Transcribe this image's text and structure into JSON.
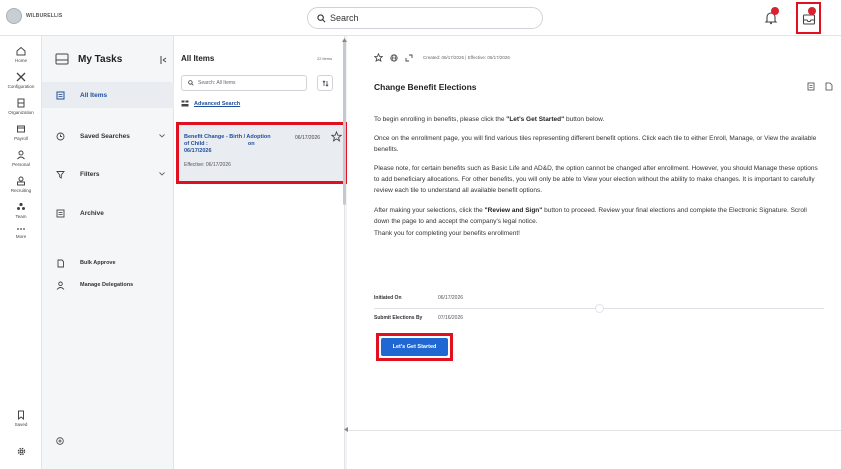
{
  "brand": {
    "name": "WILBURELLIS"
  },
  "search": {
    "label": "Search"
  },
  "nav": [
    {
      "label": "Home"
    },
    {
      "label": "Configuration"
    },
    {
      "label": "Organization"
    },
    {
      "label": "Payroll"
    },
    {
      "label": "Personal"
    },
    {
      "label": "Recruiting"
    },
    {
      "label": "Team"
    },
    {
      "label": "More"
    },
    {
      "label": "Saved"
    }
  ],
  "tasks": {
    "title": "My Tasks",
    "items": [
      {
        "label": "All Items"
      },
      {
        "label": "Saved Searches"
      },
      {
        "label": "Filters"
      },
      {
        "label": "Archive"
      },
      {
        "label": "Bulk Approve"
      },
      {
        "label": "Manage Delegations"
      }
    ]
  },
  "list": {
    "title": "All Items",
    "count": "22 items",
    "search_placeholder": "Search: All Items",
    "advanced_search": "Advanced Search",
    "item": {
      "title_line1": "Benefit Change - Birth / Adoption",
      "title_line2": "of Child :",
      "title_on": "on",
      "title_line3": "06/17/2026",
      "date": "06/17/2026",
      "effective": "Effective: 06/17/2026"
    }
  },
  "detail": {
    "meta": "Created: 06/17/2026 | Effective: 06/17/2026",
    "title": "Change Benefit Elections",
    "p1_pre": "To begin enrolling in benefits, please click the ",
    "p1_bold": "\"Let's Get Started\"",
    "p1_post": " button below.",
    "p2": "Once on the enrollment page, you will find various tiles representing different benefit options. Click each tile to either Enroll, Manage, or View the available benefits.",
    "p3": "Please note, for certain benefits such as Basic Life and AD&D, the option cannot be changed after enrollment. However, you should Manage these options to add beneficiary allocations. For other benefits, you will only be able to View your election without the ability to make changes. It is important to carefully review each tile to understand all available benefit options.",
    "p4_pre": "After making your selections, click the ",
    "p4_bold": "\"Review and Sign\"",
    "p4_post": " button to proceed. Review your final elections and complete the Electronic Signature. Scroll down the page to and accept the company's legal notice.",
    "p5": "Thank you for completing your benefits enrollment!",
    "initiated_label": "Initiated On",
    "initiated_value": "06/17/2026",
    "submit_label": "Submit Elections By",
    "submit_value": "07/16/2026",
    "start_button": "Let's Get Started"
  },
  "colors": {
    "accent": "#1f67d2",
    "link": "#1f4e9c",
    "highlight": "#e01020",
    "badge": "#d6232f"
  }
}
